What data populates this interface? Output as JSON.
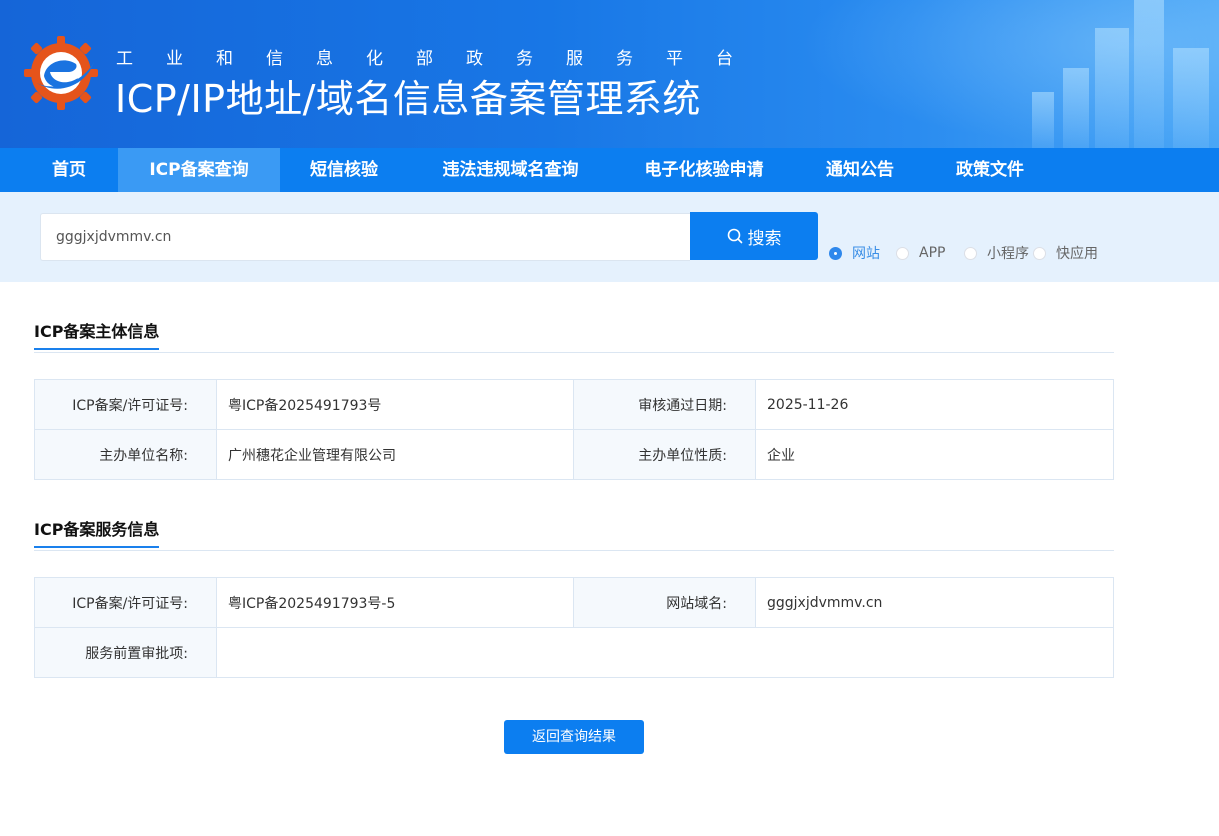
{
  "header": {
    "subtitle": "工业和信息化部政务服务平台",
    "title": "ICP/IP地址/域名信息备案管理系统"
  },
  "nav": {
    "items": [
      {
        "label": "首页",
        "active": false
      },
      {
        "label": "ICP备案查询",
        "active": true
      },
      {
        "label": "短信核验",
        "active": false
      },
      {
        "label": "违法违规域名查询",
        "active": false
      },
      {
        "label": "电子化核验申请",
        "active": false
      },
      {
        "label": "通知公告",
        "active": false
      },
      {
        "label": "政策文件",
        "active": false
      }
    ]
  },
  "search": {
    "value": "gggjxjdvmmv.cn",
    "button_label": "搜索",
    "icon": "search-icon",
    "types": [
      {
        "label": "网站",
        "checked": true
      },
      {
        "label": "APP",
        "checked": false
      },
      {
        "label": "小程序",
        "checked": false
      },
      {
        "label": "快应用",
        "checked": false
      }
    ]
  },
  "subject_info": {
    "title": "ICP备案主体信息",
    "rows": [
      {
        "label1": "ICP备案/许可证号:",
        "value1": "粤ICP备2025491793号",
        "label2": "审核通过日期:",
        "value2": "2025-11-26"
      },
      {
        "label1": "主办单位名称:",
        "value1": "广州穗花企业管理有限公司",
        "label2": "主办单位性质:",
        "value2": "企业"
      }
    ]
  },
  "service_info": {
    "title": "ICP备案服务信息",
    "license_label": "ICP备案/许可证号:",
    "license_value": "粤ICP备2025491793号-5",
    "domain_label": "网站域名:",
    "domain_value": "gggjxjdvmmv.cn",
    "approval_label": "服务前置审批项:",
    "approval_value": ""
  },
  "back_button_label": "返回查询结果",
  "colors": {
    "primary": "#0c7ef0",
    "nav_active": "#3a9af4",
    "search_band": "#e5f1fd",
    "label_cell": "#f5f9fd"
  }
}
